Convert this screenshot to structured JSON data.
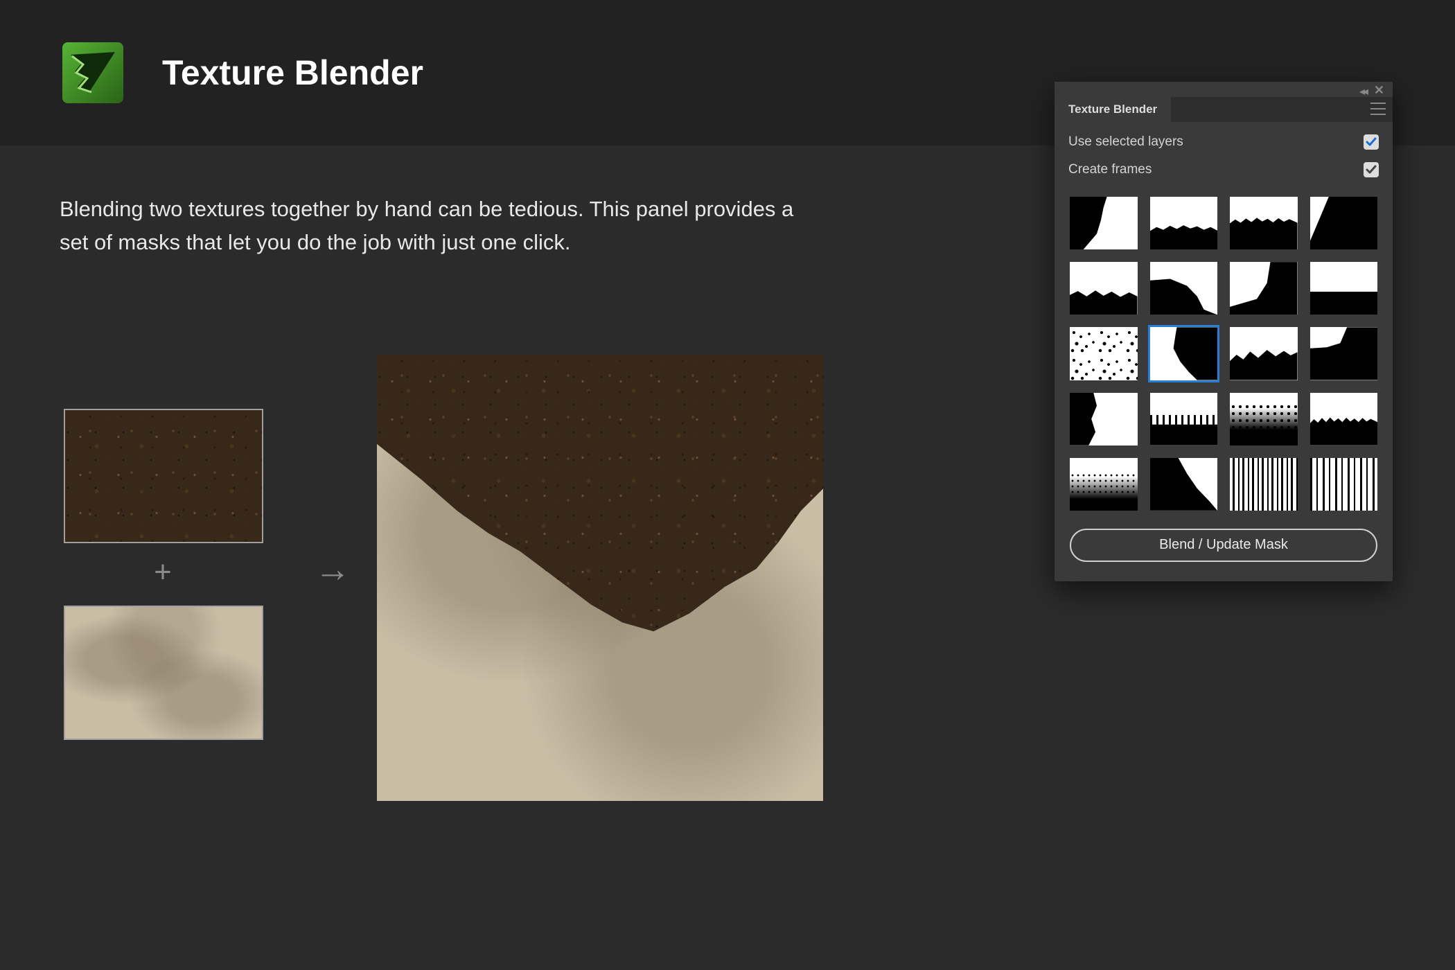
{
  "header": {
    "title": "Texture Blender"
  },
  "description": "Blending two textures together by hand can be tedious. This panel provides a set of masks that let you do the job with just one click.",
  "combine_symbol": "+",
  "arrow_symbol": "→",
  "panel": {
    "tab_title": "Texture Blender",
    "options": {
      "use_selected_layers": {
        "label": "Use selected layers",
        "checked": true
      },
      "create_frames": {
        "label": "Create frames",
        "checked": true
      }
    },
    "mask_count": 20,
    "selected_mask_index": 9,
    "blend_button": "Blend / Update Mask"
  }
}
